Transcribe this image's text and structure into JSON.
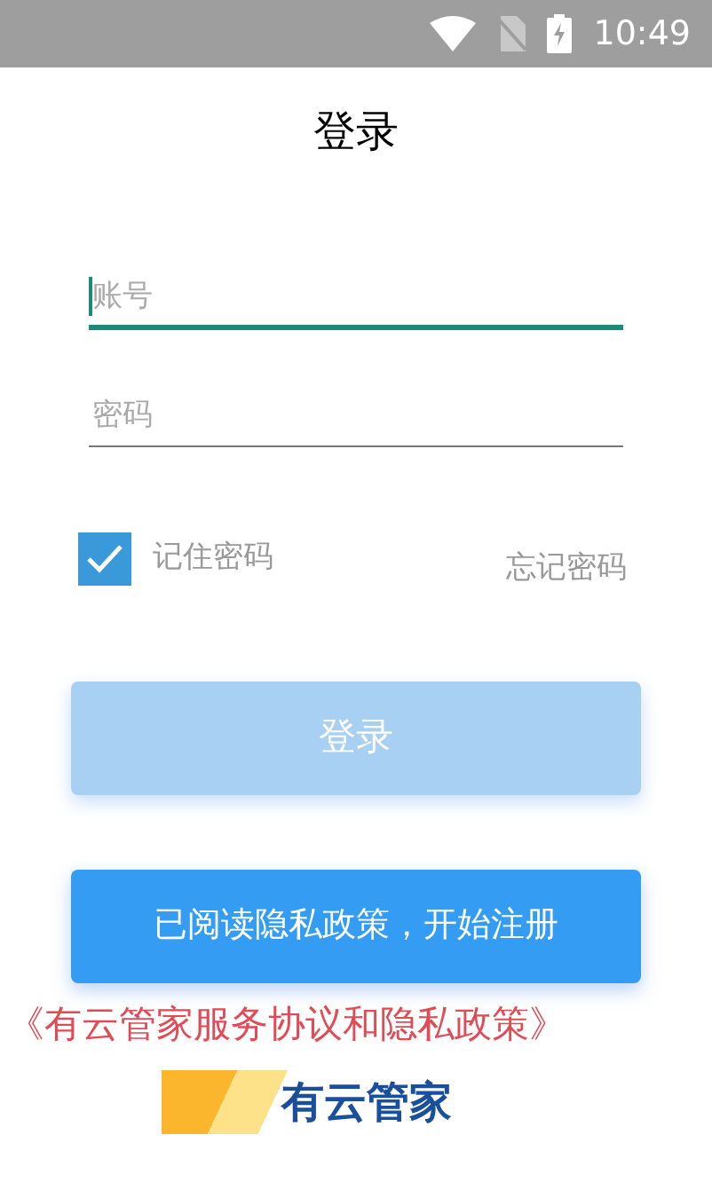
{
  "status_bar": {
    "time": "10:49"
  },
  "title": "登录",
  "fields": [
    {
      "placeholder": "账号",
      "focused": true
    },
    {
      "placeholder": "密码",
      "focused": false
    }
  ],
  "remember": {
    "label": "记住密码",
    "checked": true
  },
  "forgot_link": "忘记密码",
  "login_button": {
    "label": "登录",
    "disabled": true
  },
  "register_button": {
    "label": "已阅读隐私政策，开始注册",
    "disabled": false
  },
  "policy_link": "《有云管家服务协议和隐私政策》",
  "logo": {
    "text": "有云管家"
  }
}
